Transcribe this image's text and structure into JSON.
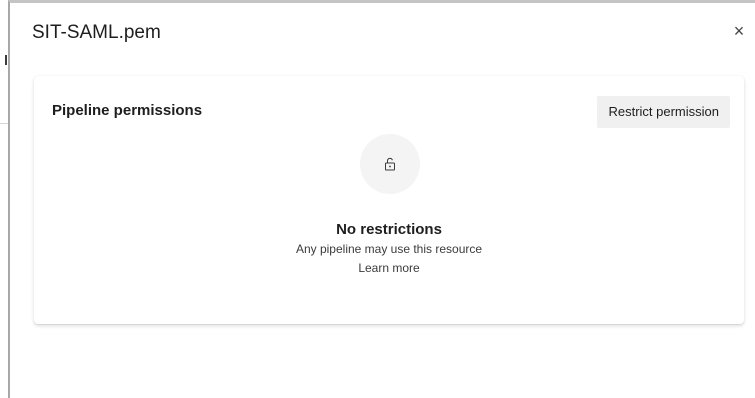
{
  "dialog": {
    "title": "SIT-SAML.pem",
    "close_glyph": "×"
  },
  "permissions": {
    "heading": "Pipeline permissions",
    "restrict_button_label": "Restrict permission",
    "empty_state": {
      "icon": "unlock-icon",
      "title": "No restrictions",
      "description": "Any pipeline may use this resource",
      "link_label": "Learn more"
    }
  },
  "colors": {
    "button_background": "#f0f0f0",
    "text_primary": "#1e1e1e",
    "icon_circle": "#f4f4f4"
  }
}
